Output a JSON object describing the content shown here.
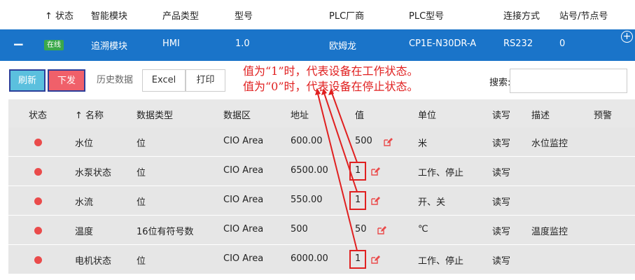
{
  "device_table": {
    "headers": {
      "status": "↑ 状态",
      "module": "智能模块",
      "product_type": "产品类型",
      "model": "型号",
      "vendor": "PLC厂商",
      "plc_model": "PLC型号",
      "connection": "连接方式",
      "station": "站号/节点号"
    },
    "selected_row": {
      "collapse": "−",
      "status_badge": "在线",
      "module": "追溯模块",
      "product_type": "HMI",
      "model": "1.0",
      "vendor": "欧姆龙",
      "plc_model": "CP1E-N30DR-A",
      "connection": "RS232",
      "station": "0"
    },
    "add_icon": "+"
  },
  "toolbar": {
    "refresh": "刷新",
    "send": "下发",
    "history": "历史数据",
    "excel": "Excel",
    "print": "打印",
    "search_label": "搜索:",
    "search_value": ""
  },
  "annotations": {
    "line1": "值为“1”时，代表设备在工作状态。",
    "line2": "值为“0”时，代表设备在停止状态。"
  },
  "data_table": {
    "headers": {
      "status": "状态",
      "name": "↑ 名称",
      "data_type": "数据类型",
      "area": "数据区",
      "address": "地址",
      "value": "值",
      "unit": "单位",
      "rw": "读写",
      "desc": "描述",
      "alarm": "预警"
    },
    "rows": [
      {
        "name": "水位",
        "data_type": "位",
        "area": "CIO Area",
        "address": "600.00",
        "value": "500",
        "unit": "米",
        "rw": "读写",
        "desc": "水位监控"
      },
      {
        "name": "水泵状态",
        "data_type": "位",
        "area": "CIO Area",
        "address": "6500.00",
        "value": "1",
        "unit": "工作、停止",
        "rw": "读写",
        "desc": ""
      },
      {
        "name": "水流",
        "data_type": "位",
        "area": "CIO Area",
        "address": "550.00",
        "value": "1",
        "unit": "开、关",
        "rw": "读写",
        "desc": ""
      },
      {
        "name": "温度",
        "data_type": "16位有符号数",
        "area": "CIO Area",
        "address": "500",
        "value": "50",
        "unit": "℃",
        "rw": "读写",
        "desc": "温度监控"
      },
      {
        "name": "电机状态",
        "data_type": "位",
        "area": "CIO Area",
        "address": "6000.00",
        "value": "1",
        "unit": "工作、停止",
        "rw": "读写",
        "desc": ""
      }
    ]
  },
  "colors": {
    "selected_row": "#1a74c9",
    "online": "#3aa84a",
    "refresh": "#5bc0de",
    "send": "#f0606a",
    "status_dot": "#ea4b4b",
    "annotation": "#e02020"
  },
  "icons": {
    "edit": "pencil-square-icon",
    "status": "red-dot-icon",
    "add": "plus-circle-icon"
  }
}
